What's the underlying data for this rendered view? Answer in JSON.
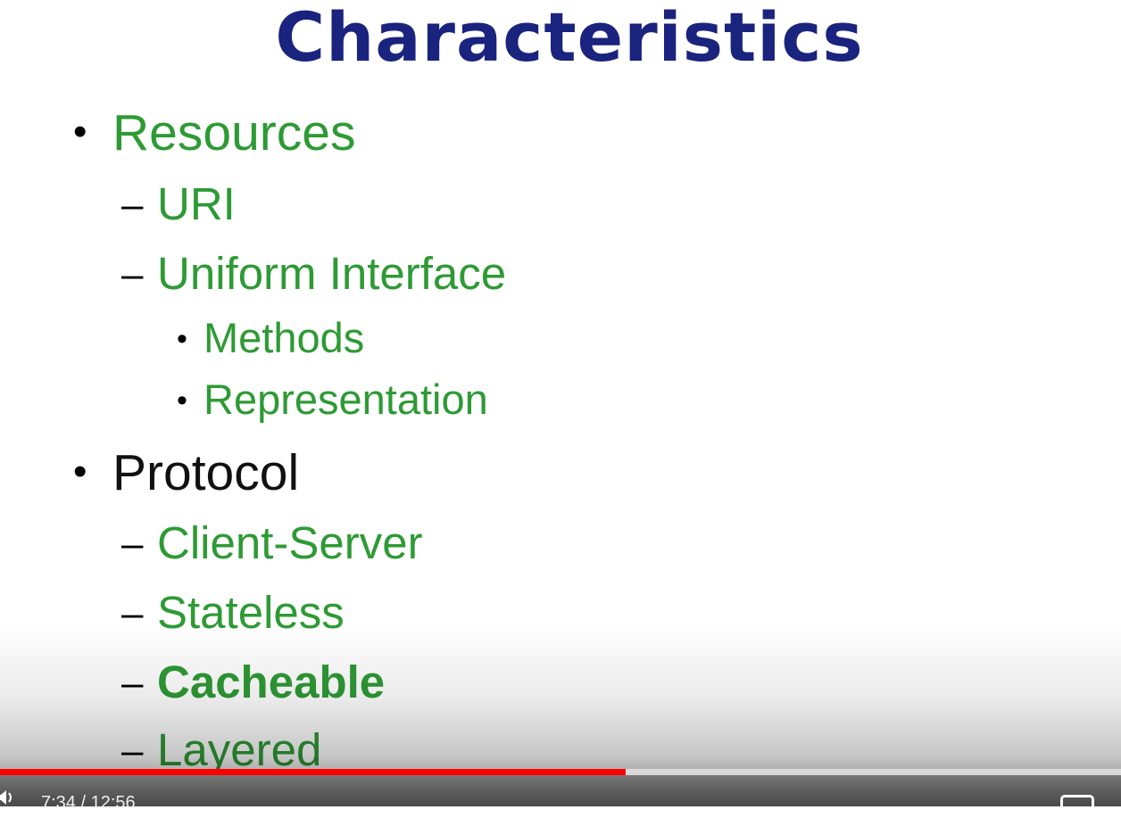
{
  "slide": {
    "title": "Characteristics",
    "title_color": "#1a237e",
    "text_green": "#2e9a35",
    "text_black": "#111111",
    "items": [
      {
        "level": 1,
        "marker": "•",
        "text": "Resources",
        "color": "green",
        "bold": false
      },
      {
        "level": 2,
        "marker": "–",
        "text": "URI",
        "color": "green",
        "bold": false
      },
      {
        "level": 2,
        "marker": "–",
        "text": "Uniform Interface",
        "color": "green",
        "bold": false
      },
      {
        "level": 3,
        "marker": "•",
        "text": "Methods",
        "color": "green",
        "bold": false
      },
      {
        "level": 3,
        "marker": "•",
        "text": "Representation",
        "color": "green",
        "bold": false
      },
      {
        "level": 1,
        "marker": "•",
        "text": "Protocol",
        "color": "black",
        "bold": false
      },
      {
        "level": 2,
        "marker": "–",
        "text": "Client-Server",
        "color": "green",
        "bold": false
      },
      {
        "level": 2,
        "marker": "–",
        "text": "Stateless",
        "color": "green",
        "bold": false
      },
      {
        "level": 2,
        "marker": "–",
        "text": "Cacheable",
        "color": "green",
        "bold": true
      },
      {
        "level": 2,
        "marker": "–",
        "text": "Layered",
        "color": "green",
        "bold": false
      }
    ]
  },
  "player": {
    "time_display": "7:34 / 12:56",
    "progress_fraction": 0.558,
    "progress_color": "#ff0000",
    "volume_icon": "volume-icon",
    "captions_icon": "closed-captions-icon"
  }
}
